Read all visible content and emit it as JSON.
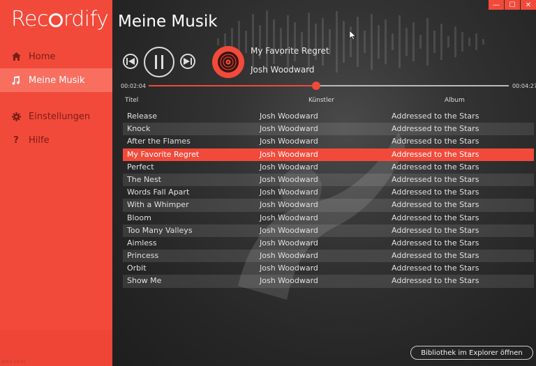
{
  "app": {
    "name": "Recordify",
    "version": "2017-12-01"
  },
  "sidebar": {
    "items": [
      {
        "label": "Home",
        "icon": "home-icon",
        "active": false
      },
      {
        "label": "Meine Musik",
        "icon": "music-note-icon",
        "active": true
      },
      {
        "label": "Einstellungen",
        "icon": "gear-icon",
        "active": false
      },
      {
        "label": "Hilfe",
        "icon": "question-icon",
        "active": false
      }
    ]
  },
  "main": {
    "title": "Meine Musik"
  },
  "window_controls": [
    "minimize-icon",
    "maximize-icon",
    "close-icon"
  ],
  "player": {
    "track_title": "My Favorite Regret",
    "artist": "Josh Woodward",
    "current_time": "00:02:04",
    "total_time": "00:04:27",
    "progress": 0.465
  },
  "table": {
    "columns": [
      "Titel",
      "Künstler",
      "Album"
    ],
    "rows": [
      {
        "title": "Release",
        "artist": "Josh Woodward",
        "album": "Addressed to the Stars"
      },
      {
        "title": "Knock",
        "artist": "Josh Woodward",
        "album": "Addressed to the Stars"
      },
      {
        "title": "After the Flames",
        "artist": "Josh Woodward",
        "album": "Addressed to the Stars"
      },
      {
        "title": "My Favorite Regret",
        "artist": "Josh Woodward",
        "album": "Addressed to the Stars",
        "playing": true
      },
      {
        "title": "Perfect",
        "artist": "Josh Woodward",
        "album": "Addressed to the Stars"
      },
      {
        "title": "The Nest",
        "artist": "Josh Woodward",
        "album": "Addressed to the Stars"
      },
      {
        "title": "Words Fall Apart",
        "artist": "Josh Woodward",
        "album": "Addressed to the Stars"
      },
      {
        "title": "With a Whimper",
        "artist": "Josh Woodward",
        "album": "Addressed to the Stars"
      },
      {
        "title": "Bloom",
        "artist": "Josh Woodward",
        "album": "Addressed to the Stars"
      },
      {
        "title": "Too Many Valleys",
        "artist": "Josh Woodward",
        "album": "Addressed to the Stars"
      },
      {
        "title": "Aimless",
        "artist": "Josh Woodward",
        "album": "Addressed to the Stars"
      },
      {
        "title": "Princess",
        "artist": "Josh Woodward",
        "album": "Addressed to the Stars"
      },
      {
        "title": "Orbit",
        "artist": "Josh Woodward",
        "album": "Addressed to the Stars"
      },
      {
        "title": "Show Me",
        "artist": "Josh Woodward",
        "album": "Addressed to the Stars"
      }
    ]
  },
  "footer": {
    "explorer_button": "Bibliothek im Explorer öffnen"
  },
  "colors": {
    "accent": "#f24a3a",
    "active_nav": "#f86f60",
    "nav_text": "#7a1d16",
    "background": "#2a2a2a"
  }
}
